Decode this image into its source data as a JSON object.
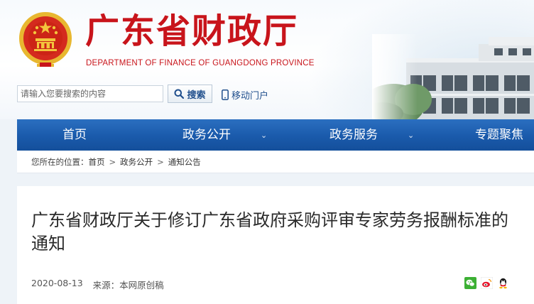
{
  "header": {
    "title": "广东省财政厅",
    "subtitle": "DEPARTMENT OF FINANCE OF GUANGDONG PROVINCE"
  },
  "search": {
    "placeholder": "请输入您要搜索的内容",
    "button_label": "搜索"
  },
  "mobile_link": {
    "label": "移动门户"
  },
  "nav": {
    "items": [
      {
        "label": "首页"
      },
      {
        "label": "政务公开"
      },
      {
        "label": "政务服务"
      },
      {
        "label": "专题聚焦"
      }
    ]
  },
  "breadcrumb": {
    "prefix": "您所在的位置：",
    "items": [
      "首页",
      "政务公开",
      "通知公告"
    ],
    "separator": ">"
  },
  "article": {
    "title": "广东省财政厅关于修订广东省政府采购评审专家劳务报酬标准的通知",
    "date": "2020-08-13",
    "source": "来源：本网原创稿"
  },
  "share_icons": [
    "wechat-icon",
    "weibo-icon",
    "qq-icon"
  ],
  "colors": {
    "brand_red": "#c8141b",
    "nav_blue": "#1a5aab",
    "link_blue": "#1f4e8c"
  }
}
